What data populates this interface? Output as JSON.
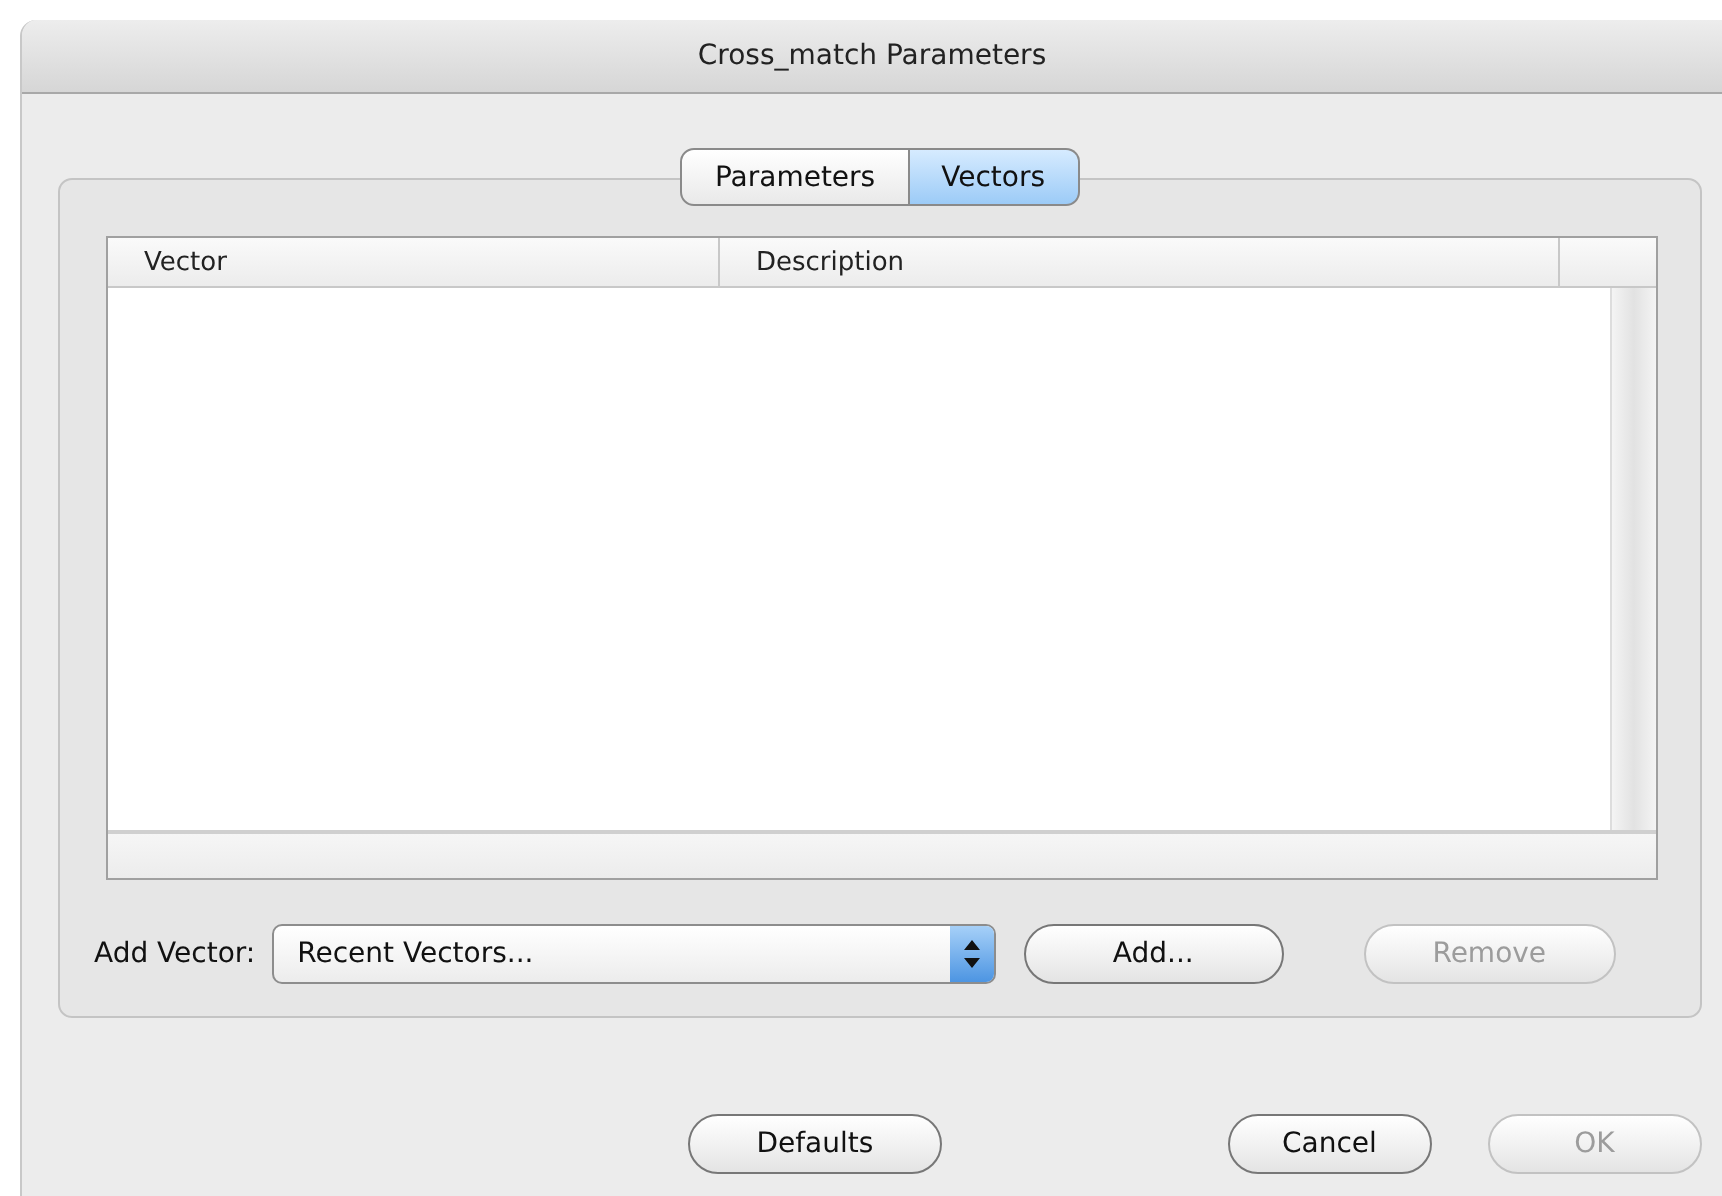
{
  "window": {
    "title": "Cross_match Parameters"
  },
  "tabs": [
    {
      "label": "Parameters",
      "selected": false
    },
    {
      "label": "Vectors",
      "selected": true
    }
  ],
  "table": {
    "columns": [
      "Vector",
      "Description"
    ]
  },
  "add_vector": {
    "label": "Add Vector:",
    "value": "Recent Vectors..."
  },
  "panel_buttons": [
    {
      "label": "Add...",
      "disabled": false
    },
    {
      "label": "Remove",
      "disabled": true
    }
  ],
  "footer_buttons": [
    {
      "label": "Defaults",
      "disabled": false
    },
    {
      "label": "Cancel",
      "disabled": false
    },
    {
      "label": "OK",
      "disabled": true
    }
  ]
}
